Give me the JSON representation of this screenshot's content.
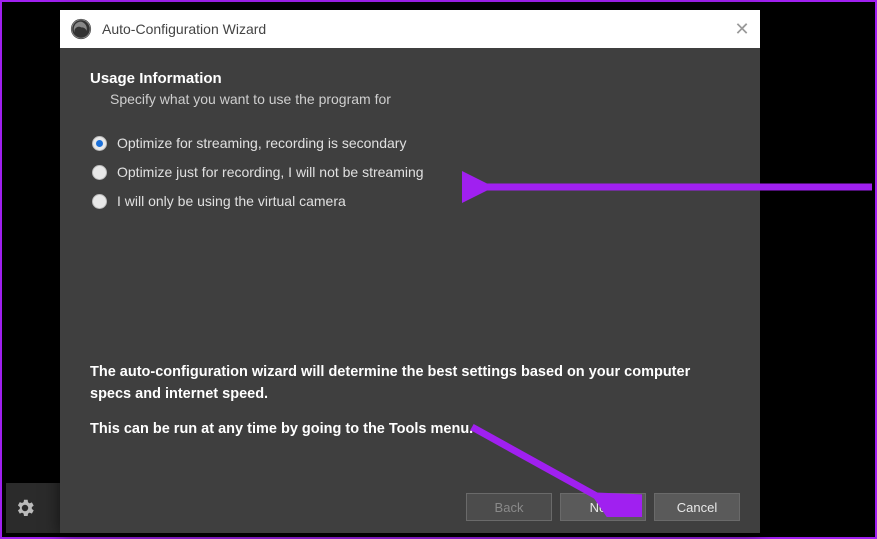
{
  "titlebar": {
    "title": "Auto-Configuration Wizard"
  },
  "section": {
    "heading": "Usage Information",
    "subheading": "Specify what you want to use the program for"
  },
  "options": [
    {
      "label": "Optimize for streaming, recording is secondary",
      "selected": true
    },
    {
      "label": "Optimize just for recording, I will not be streaming",
      "selected": false
    },
    {
      "label": "I will only be using the virtual camera",
      "selected": false
    }
  ],
  "note": {
    "line1": "The auto-configuration wizard will determine the best settings based on your computer specs and internet speed.",
    "line2": "This can be run at any time by going to the Tools menu."
  },
  "buttons": {
    "back": "Back",
    "next": "Next",
    "cancel": "Cancel"
  },
  "colors": {
    "accent": "#a020f0",
    "radio_selected": "#1a6fd8",
    "dialog_bg": "#3f3f3f"
  }
}
